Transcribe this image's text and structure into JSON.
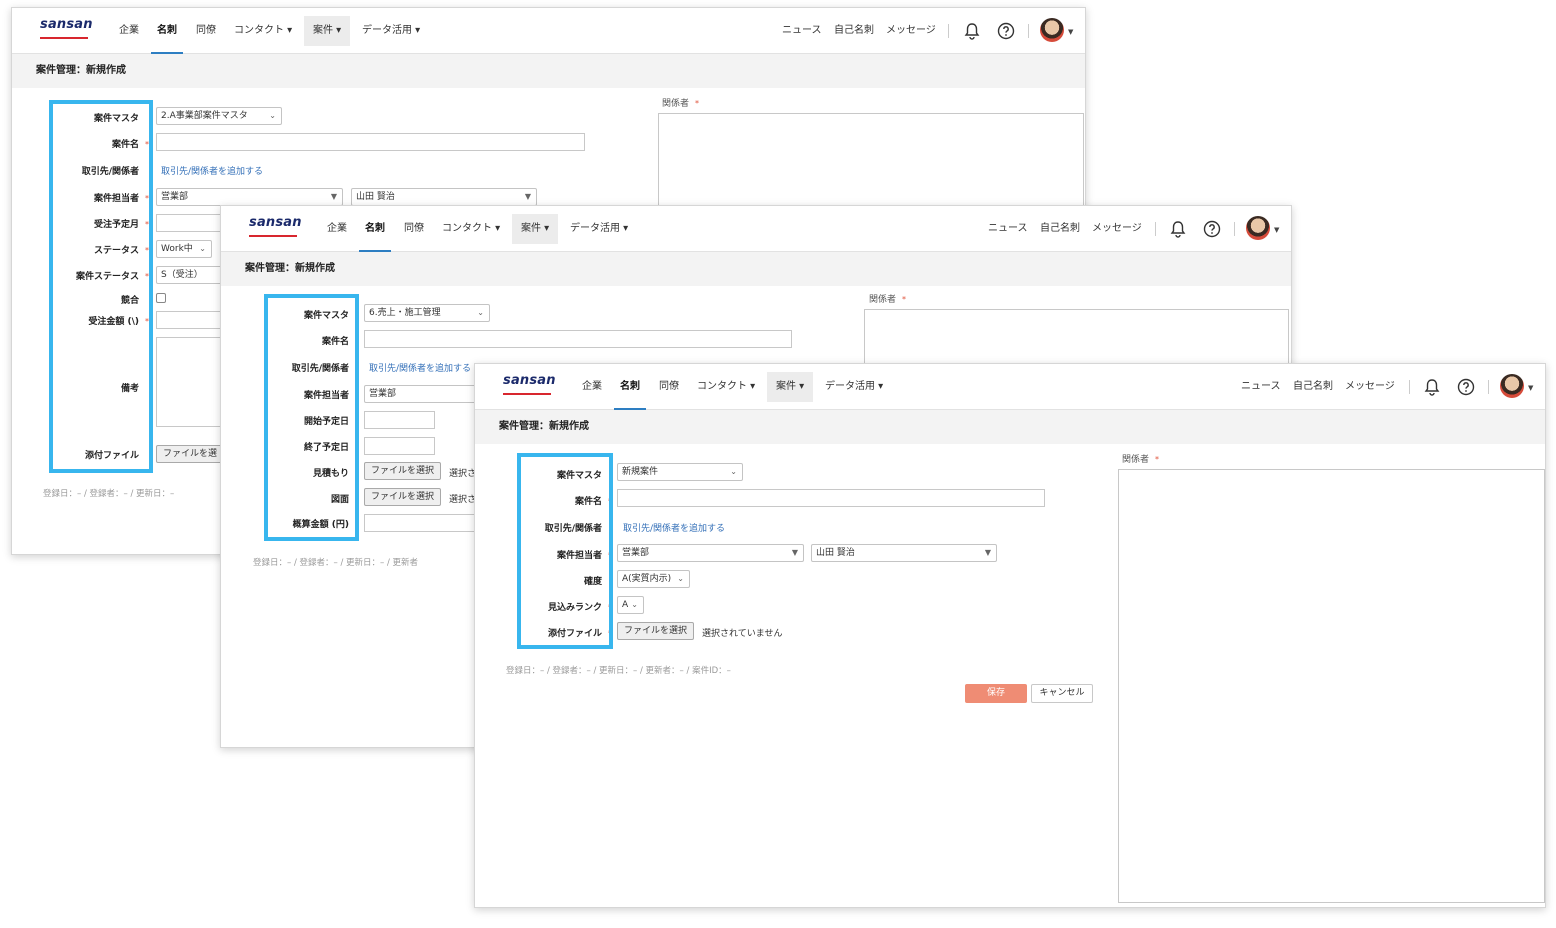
{
  "nav": {
    "logo": "sansan",
    "items": [
      "企業",
      "名刺",
      "同僚",
      "コンタクト ▾",
      "案件 ▾",
      "データ活用 ▾"
    ],
    "right": [
      "ニュース",
      "自己名刺",
      "メッセージ"
    ]
  },
  "colors": {
    "highlight": "#38b6ee",
    "required": "#e0543c",
    "link": "#3470b8",
    "save": "#ef8c74",
    "logo": "#1b2a6b",
    "logo_underline": "#d8262e"
  },
  "page_title": "案件管理：新規作成",
  "relations_label": "関係者",
  "required_mark": "*",
  "chevron": "⌄",
  "window1": {
    "labels": [
      "案件マスタ",
      "案件名",
      "取引先/関係者",
      "案件担当者",
      "受注予定月",
      "ステータス",
      "案件ステータス",
      "競合",
      "受注金額 (\\)",
      "備考",
      "添付ファイル"
    ],
    "master_value": "2.A事業部案件マスタ",
    "add_link": "取引先/関係者を追加する",
    "dept_value": "営業部",
    "person_value": "山田 賢治",
    "status_value": "Work中",
    "deal_status_value": "S（受注）",
    "file_button": "ファイルを選",
    "meta": "登録日：– / 登録者：– / 更新日：–"
  },
  "window2": {
    "labels": [
      "案件マスタ",
      "案件名",
      "取引先/関係者",
      "案件担当者",
      "開始予定日",
      "終了予定日",
      "見積もり",
      "図面",
      "概算金額 (円)"
    ],
    "master_value": "6.売上・施工管理",
    "add_link": "取引先/関係者を追加する",
    "dept_value": "営業部",
    "file_button": "ファイルを選択",
    "file_text": "選択さ",
    "meta": "登録日：– / 登録者：– / 更新日：– / 更新者"
  },
  "window3": {
    "labels": [
      "案件マスタ",
      "案件名",
      "取引先/関係者",
      "案件担当者",
      "確度",
      "見込みランク",
      "添付ファイル"
    ],
    "master_value": "新規案件",
    "add_link": "取引先/関係者を追加する",
    "dept_value": "営業部",
    "person_value": "山田 賢治",
    "certainty_value": "A(実質内示)",
    "rank_value": "A",
    "file_button": "ファイルを選択",
    "file_text": "選択されていません",
    "meta": "登録日：– / 登録者：– / 更新日：– / 更新者：– / 案件ID：–",
    "save": "保存",
    "cancel": "キャンセル"
  }
}
